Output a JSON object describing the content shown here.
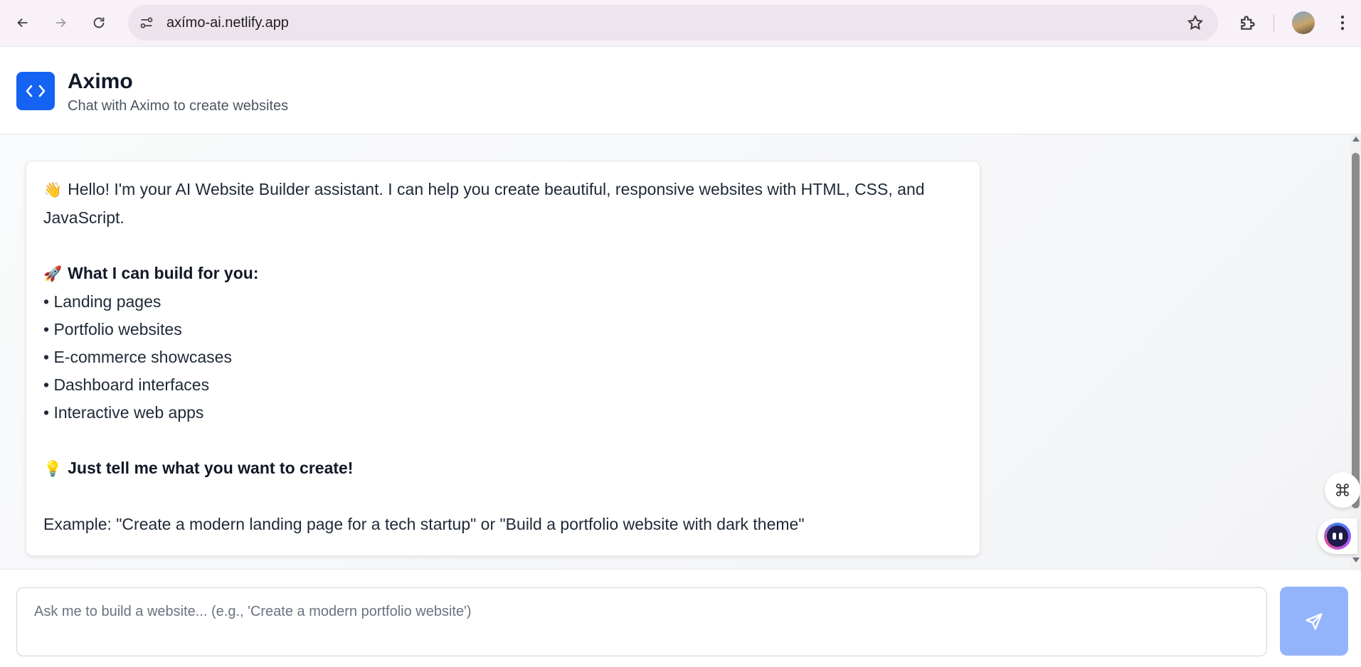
{
  "browser": {
    "url": "axímo-ai.netlify.app",
    "back_icon": "arrow-left-icon",
    "forward_icon": "arrow-right-icon",
    "reload_icon": "reload-icon",
    "bookmark_icon": "star-icon",
    "extensions_icon": "puzzle-icon",
    "menu_icon": "kebab-menu-icon"
  },
  "header": {
    "title": "Aximo",
    "subtitle": "Chat with Aximo to create websites",
    "logo_icon": "code-brackets-icon",
    "accent_color": "#1463f3"
  },
  "message": {
    "intro_emoji": "👋",
    "intro": "Hello! I'm your AI Website Builder assistant. I can help you create beautiful, responsive websites with HTML, CSS, and JavaScript.",
    "build_emoji": "🚀",
    "build_heading": "What I can build for you:",
    "items": [
      "• Landing pages",
      "• Portfolio websites",
      "• E-commerce showcases",
      "• Dashboard interfaces",
      "• Interactive web apps"
    ],
    "tip_emoji": "💡",
    "tip": "Just tell me what you want to create!",
    "example": "Example: \"Create a modern landing page for a tech startup\" or \"Build a portfolio website with dark theme\""
  },
  "input": {
    "placeholder": "Ask me to build a website... (e.g., 'Create a modern portfolio website')",
    "value": ""
  },
  "send_button": {
    "icon": "send-icon",
    "color": "#93b4fb"
  }
}
